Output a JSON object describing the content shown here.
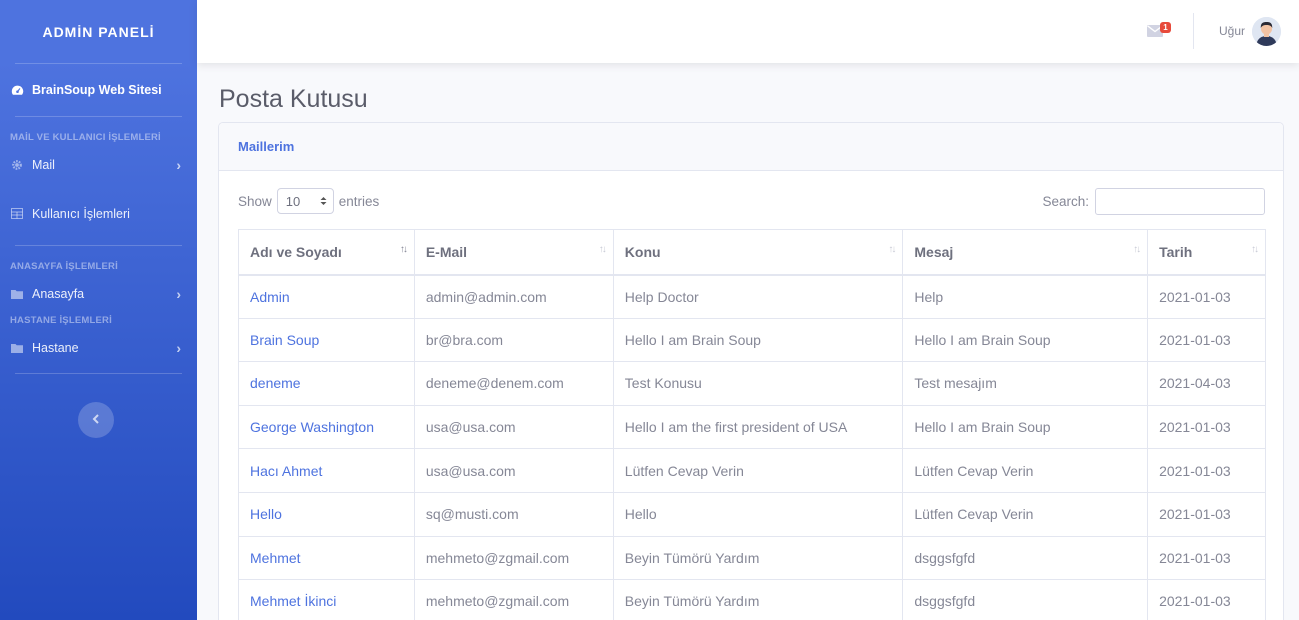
{
  "sidebar": {
    "brand": "ADMİN PANELİ",
    "site_link": "BrainSoup Web Sitesi",
    "sections": [
      {
        "heading": "MAİL VE KULLANICI İŞLEMLERİ"
      },
      {
        "heading": "ANASAYFA İŞLEMLERİ"
      },
      {
        "heading": "HASTANE İŞLEMLERİ"
      }
    ],
    "items": {
      "mail": "Mail",
      "users": "Kullanıcı İşlemleri",
      "home": "Anasayfa",
      "hospital": "Hastane"
    }
  },
  "topbar": {
    "mail_badge": "1",
    "user_name": "Uğur"
  },
  "page": {
    "title": "Posta Kutusu",
    "card_title": "Maillerim",
    "show_label": "Show",
    "entries_value": "10",
    "entries_label": "entries",
    "search_label": "Search:"
  },
  "table": {
    "columns": [
      "Adı ve Soyadı",
      "E-Mail",
      "Konu",
      "Mesaj",
      "Tarih"
    ],
    "rows": [
      [
        "Admin",
        "admin@admin.com",
        "Help Doctor",
        "Help",
        "2021-01-03"
      ],
      [
        "Brain Soup",
        "br@bra.com",
        "Hello I am Brain Soup",
        "Hello I am Brain Soup",
        "2021-01-03"
      ],
      [
        "deneme",
        "deneme@denem.com",
        "Test Konusu",
        "Test mesajım",
        "2021-04-03"
      ],
      [
        "George Washington",
        "usa@usa.com",
        "Hello I am the first president of USA",
        "Hello I am Brain Soup",
        "2021-01-03"
      ],
      [
        "Hacı Ahmet",
        "usa@usa.com",
        "Lütfen Cevap Verin",
        "Lütfen Cevap Verin",
        "2021-01-03"
      ],
      [
        "Hello",
        "sq@musti.com",
        "Hello",
        "Lütfen Cevap Verin",
        "2021-01-03"
      ],
      [
        "Mehmet",
        "mehmeto@zgmail.com",
        "Beyin Tümörü Yardım",
        "dsggsfgfd",
        "2021-01-03"
      ],
      [
        "Mehmet İkinci",
        "mehmeto@zgmail.com",
        "Beyin Tümörü Yardım",
        "dsggsfgfd",
        "2021-01-03"
      ]
    ]
  },
  "colors": {
    "primary": "#4e73df",
    "sidebar_end": "#224abe",
    "badge": "#e74a3b"
  }
}
